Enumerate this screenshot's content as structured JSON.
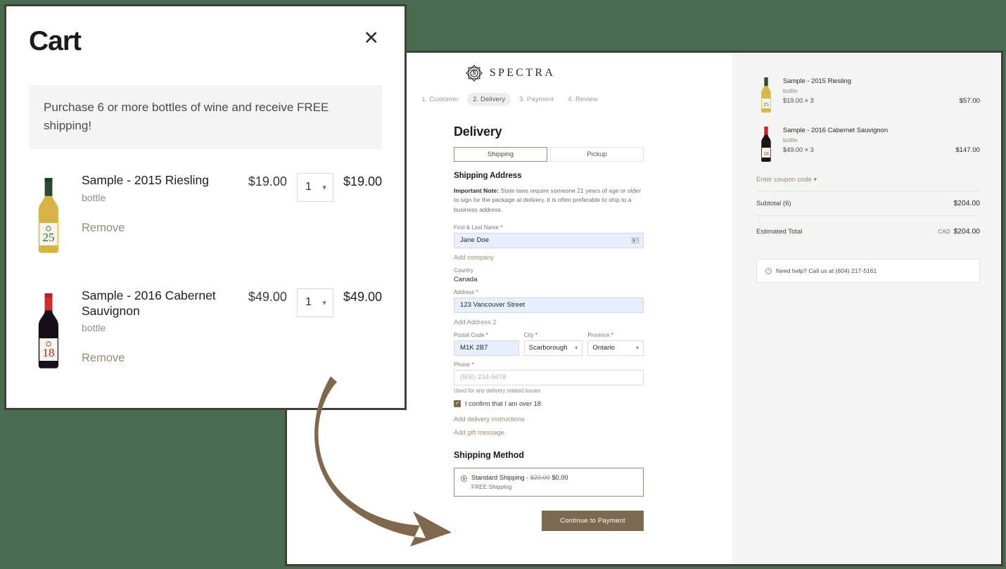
{
  "colors": {
    "page_background": "#4a6b4d",
    "accent_brown": "#7d6a52",
    "link_tan": "#9d8a73",
    "summary_background": "#f4f4f2",
    "arrow": "#80684e",
    "required_red": "#cc3b2e",
    "input_filled": "#e8effc"
  },
  "cart": {
    "title": "Cart",
    "close_icon": "close-icon",
    "promo_message": "Purchase 6 or more bottles of wine and receive FREE shipping!",
    "items": [
      {
        "name": "Sample - 2015 Riesling",
        "variant": "bottle",
        "remove_label": "Remove",
        "unit_price": "$19.00",
        "quantity": "1",
        "line_total": "$19.00",
        "thumb": "white-wine-bottle-image"
      },
      {
        "name": "Sample - 2016 Cabernet Sauvignon",
        "variant": "bottle",
        "remove_label": "Remove",
        "unit_price": "$49.00",
        "quantity": "1",
        "line_total": "$49.00",
        "thumb": "red-wine-bottle-image"
      }
    ]
  },
  "checkout": {
    "brand_name": "SPECTRA",
    "brand_mark": "spectra-star-logo-icon",
    "steps": [
      {
        "label": "1. Customer",
        "active": false
      },
      {
        "label": "2. Delivery",
        "active": true
      },
      {
        "label": "3. Payment",
        "active": false
      },
      {
        "label": "4. Review",
        "active": false
      }
    ],
    "section_title": "Delivery",
    "delivery_method_tabs": [
      {
        "label": "Shipping",
        "active": true
      },
      {
        "label": "Pickup",
        "active": false
      }
    ],
    "shipping_address_title": "Shipping Address",
    "important_note_prefix": "Important Note:",
    "important_note_body": " State laws require someone 21 years of age or older to sign for the package at delivery, it is often preferable to ship to a business address.",
    "fields": {
      "name_label": "First & Last Name",
      "name_value": "Jane Doe",
      "name_autofill_icon": "contact-card-icon",
      "add_company_label": "Add company",
      "country_label": "Country",
      "country_value": "Canada",
      "address_label": "Address",
      "address_value": "123 Vancouver Street",
      "add_address2_label": "Add Address 2",
      "postal_label": "Postal Code",
      "postal_value": "M1K 2B7",
      "city_label": "City",
      "city_value": "Scarborough",
      "province_label": "Province",
      "province_value": "Ontario",
      "phone_label": "Phone",
      "phone_placeholder": "(506) 234-5678",
      "phone_hint": "Used for any delivery related issues",
      "age_confirm_label": "I confirm that I am over 18",
      "add_delivery_instructions_label": "Add delivery instructions",
      "add_gift_message_label": "Add gift message",
      "required_marker": "*"
    },
    "shipping_method_title": "Shipping Method",
    "shipping_option": {
      "name_prefix": "Standard Shipping - ",
      "old_price": "$20.00",
      "new_price": "$0.00",
      "sub_label": "FREE Shipping"
    },
    "continue_button": "Continue to Payment"
  },
  "summary": {
    "items": [
      {
        "name": "Sample - 2015 Riesling",
        "variant": "bottle",
        "unit_line": "$19.00 × 3",
        "line_total": "$57.00",
        "thumb": "white-wine-bottle-image"
      },
      {
        "name": "Sample - 2016 Cabernet Sauvignon",
        "variant": "bottle",
        "unit_line": "$49.00 × 3",
        "line_total": "$147.00",
        "thumb": "red-wine-bottle-image"
      }
    ],
    "coupon_label": "Enter coupon code",
    "coupon_caret": "chevron-down-icon",
    "subtotal_label": "Subtotal (6)",
    "subtotal_value": "$204.00",
    "estimated_total_label": "Estimated Total",
    "estimated_total_currency": "CAD",
    "estimated_total_value": "$204.00",
    "help_icon": "question-circle-icon",
    "help_text": "Need help? Call us at (604) 217-5161"
  },
  "annotation": {
    "arrow_icon": "curved-arrow-pointing-down-right"
  }
}
